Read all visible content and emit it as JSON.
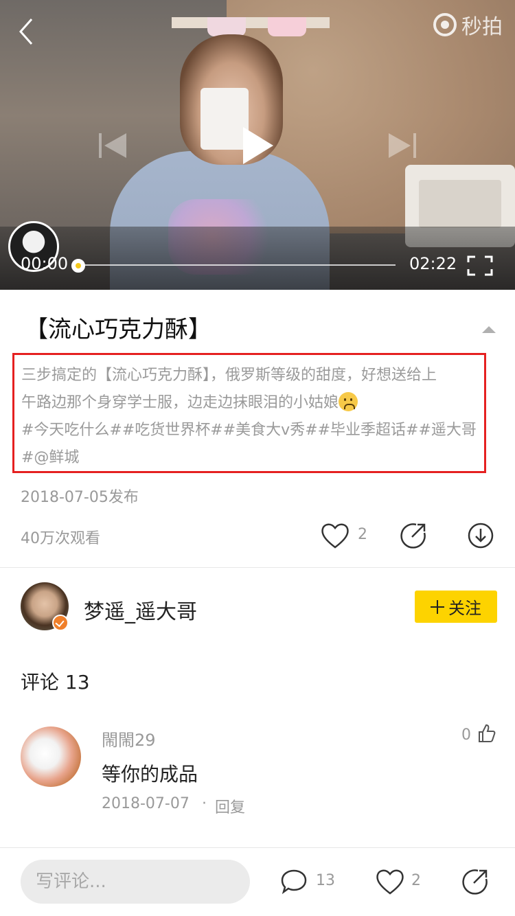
{
  "player": {
    "watermark_text": "秒拍",
    "current_time": "00:00",
    "total_time": "02:22",
    "progress": 0,
    "thumb_color": "#f4c81b"
  },
  "video": {
    "title": "【流心巧克力酥】",
    "description_lines": [
      "三步搞定的【流心巧克力酥】，俄罗斯等级的甜度，好想送给上",
      "午路边那个身穿学士服，边走边抹眼泪的小姑娘",
      "#今天吃什么##吃货世界杯##美食大v秀##毕业季超话##遥大哥",
      "#@鲜城"
    ],
    "emoji_icon": "sad-face-emoji",
    "publish_date": "2018-07-05发布",
    "views": "40万次观看",
    "likes": "2"
  },
  "author": {
    "name": "梦遥_遥大哥",
    "follow_label": "关注",
    "verified_color": "#f07f2a",
    "follow_button_color": "#fdd300"
  },
  "comments": {
    "heading": "评论 13",
    "items": [
      {
        "user": "閙閙29",
        "text": "等你的成品",
        "date": "2018-07-07",
        "separator": "·",
        "reply_label": "回复",
        "likes": "0"
      }
    ]
  },
  "bottom_bar": {
    "input_placeholder": "写评论...",
    "comment_count": "13",
    "like_count": "2"
  },
  "colors": {
    "highlight_border": "#e52020",
    "muted_text": "#999999"
  }
}
